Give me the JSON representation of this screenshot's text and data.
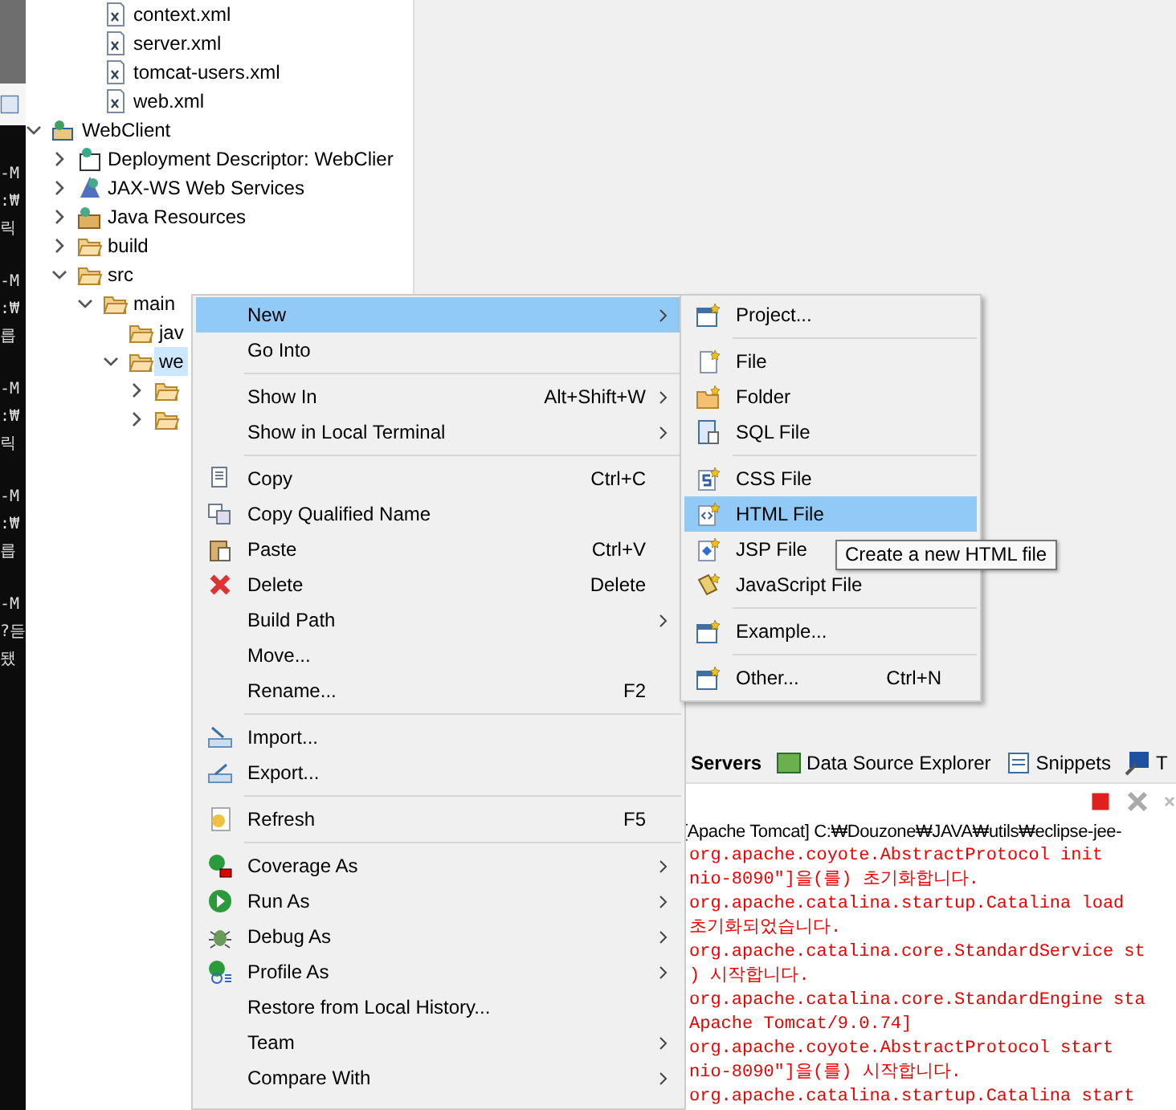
{
  "terminal": {
    "groups": [
      [
        "-M",
        ":₩",
        "릭"
      ],
      [
        "-M",
        ":₩",
        "릅"
      ],
      [
        "-M",
        ":₩",
        "릭"
      ],
      [
        "-M",
        ":₩",
        "릅"
      ],
      [
        "-M",
        "?듣",
        "됐"
      ]
    ]
  },
  "explorer": {
    "cut_top_items": [
      {
        "label": "context.xml",
        "kind": "xml",
        "selected": false
      },
      {
        "label": "server.xml",
        "kind": "xml",
        "selected": false
      },
      {
        "label": "tomcat-users.xml",
        "kind": "xml",
        "selected": false
      },
      {
        "label": "web.xml",
        "kind": "xml",
        "selected": false
      }
    ],
    "tree": [
      {
        "label": "WebClient",
        "kind": "project",
        "expanded": true,
        "selected": false,
        "children": [
          {
            "label": "Deployment Descriptor: WebClier",
            "kind": "descriptor",
            "expanded": false,
            "selected": false
          },
          {
            "label": "JAX-WS Web Services",
            "kind": "services",
            "expanded": false,
            "selected": false
          },
          {
            "label": "Java Resources",
            "kind": "resources",
            "expanded": false,
            "selected": false
          },
          {
            "label": "build",
            "kind": "folder",
            "expanded": false,
            "selected": false
          },
          {
            "label": "src",
            "kind": "folder",
            "expanded": true,
            "selected": false,
            "children": [
              {
                "label": "main",
                "kind": "folder",
                "expanded": true,
                "selected": false,
                "children": [
                  {
                    "label": "jav",
                    "kind": "folder",
                    "selected": false
                  },
                  {
                    "label": "we",
                    "kind": "folder",
                    "expanded": true,
                    "selected": true,
                    "children": [
                      {
                        "kind": "folder",
                        "expanded": false,
                        "selected": false
                      },
                      {
                        "kind": "folder",
                        "expanded": false,
                        "selected": false
                      }
                    ]
                  }
                ]
              }
            ]
          }
        ]
      }
    ]
  },
  "context_menu": {
    "items": [
      {
        "kind": "item",
        "label": "New",
        "submenu": true,
        "selected": true
      },
      {
        "kind": "item",
        "label": "Go Into",
        "selected": false
      },
      {
        "kind": "separator"
      },
      {
        "kind": "item",
        "label": "Show In",
        "shortcut": "Alt+Shift+W",
        "submenu": true,
        "selected": false
      },
      {
        "kind": "item",
        "label": "Show in Local Terminal",
        "submenu": true,
        "selected": false
      },
      {
        "kind": "separator"
      },
      {
        "kind": "item",
        "label": "Copy",
        "shortcut": "Ctrl+C",
        "selected": false
      },
      {
        "kind": "item",
        "label": "Copy Qualified Name",
        "selected": false
      },
      {
        "kind": "item",
        "label": "Paste",
        "shortcut": "Ctrl+V",
        "selected": false
      },
      {
        "kind": "item",
        "label": "Delete",
        "shortcut": "Delete",
        "selected": false
      },
      {
        "kind": "item",
        "label": "Build Path",
        "submenu": true,
        "selected": false
      },
      {
        "kind": "item",
        "label": "Move...",
        "selected": false
      },
      {
        "kind": "item",
        "label": "Rename...",
        "shortcut": "F2",
        "selected": false
      },
      {
        "kind": "separator"
      },
      {
        "kind": "item",
        "label": "Import...",
        "selected": false
      },
      {
        "kind": "item",
        "label": "Export...",
        "selected": false
      },
      {
        "kind": "separator"
      },
      {
        "kind": "item",
        "label": "Refresh",
        "shortcut": "F5",
        "selected": false
      },
      {
        "kind": "separator"
      },
      {
        "kind": "item",
        "label": "Coverage As",
        "submenu": true,
        "selected": false
      },
      {
        "kind": "item",
        "label": "Run As",
        "submenu": true,
        "selected": false
      },
      {
        "kind": "item",
        "label": "Debug As",
        "submenu": true,
        "selected": false
      },
      {
        "kind": "item",
        "label": "Profile As",
        "submenu": true,
        "selected": false
      },
      {
        "kind": "item",
        "label": "Restore from Local History...",
        "selected": false
      },
      {
        "kind": "item",
        "label": "Team",
        "submenu": true,
        "selected": false
      },
      {
        "kind": "item",
        "label": "Compare With",
        "submenu": true,
        "selected": false
      }
    ]
  },
  "new_submenu": {
    "items": [
      {
        "kind": "item",
        "label": "Project...",
        "selected": false
      },
      {
        "kind": "separator"
      },
      {
        "kind": "item",
        "label": "File",
        "selected": false
      },
      {
        "kind": "item",
        "label": "Folder",
        "selected": false
      },
      {
        "kind": "item",
        "label": "SQL File",
        "selected": false
      },
      {
        "kind": "separator"
      },
      {
        "kind": "item",
        "label": "CSS File",
        "selected": false
      },
      {
        "kind": "item",
        "label": "HTML File",
        "selected": true
      },
      {
        "kind": "item",
        "label": "JSP File",
        "selected": false
      },
      {
        "kind": "item",
        "label": "JavaScript File",
        "selected": false
      },
      {
        "kind": "separator"
      },
      {
        "kind": "item",
        "label": "Example...",
        "selected": false
      },
      {
        "kind": "separator"
      },
      {
        "kind": "item",
        "label": "Other...",
        "shortcut": "Ctrl+N",
        "selected": false
      }
    ]
  },
  "tooltip": {
    "text": "Create a new HTML file"
  },
  "console": {
    "tabs": [
      {
        "label": "Servers",
        "selected": true
      },
      {
        "label": "Data Source Explorer",
        "selected": false
      },
      {
        "label": "Snippets",
        "selected": false
      },
      {
        "label": "T",
        "selected": false
      }
    ],
    "path": "[Apache Tomcat] C:₩Douzone₩JAVA₩utils₩eclipse-jee-",
    "lines": [
      "org.apache.coyote.AbstractProtocol init",
      "nio-8090\"]을(를) 초기화합니다.",
      "org.apache.catalina.startup.Catalina load",
      "초기화되었습니다.",
      "org.apache.catalina.core.StandardService st",
      ") 시작합니다.",
      "org.apache.catalina.core.StandardEngine sta",
      "Apache Tomcat/9.0.74]",
      "org.apache.coyote.AbstractProtocol start",
      "nio-8090\"]을(를) 시작합니다.",
      "org.apache.catalina.startup.Catalina start"
    ]
  }
}
